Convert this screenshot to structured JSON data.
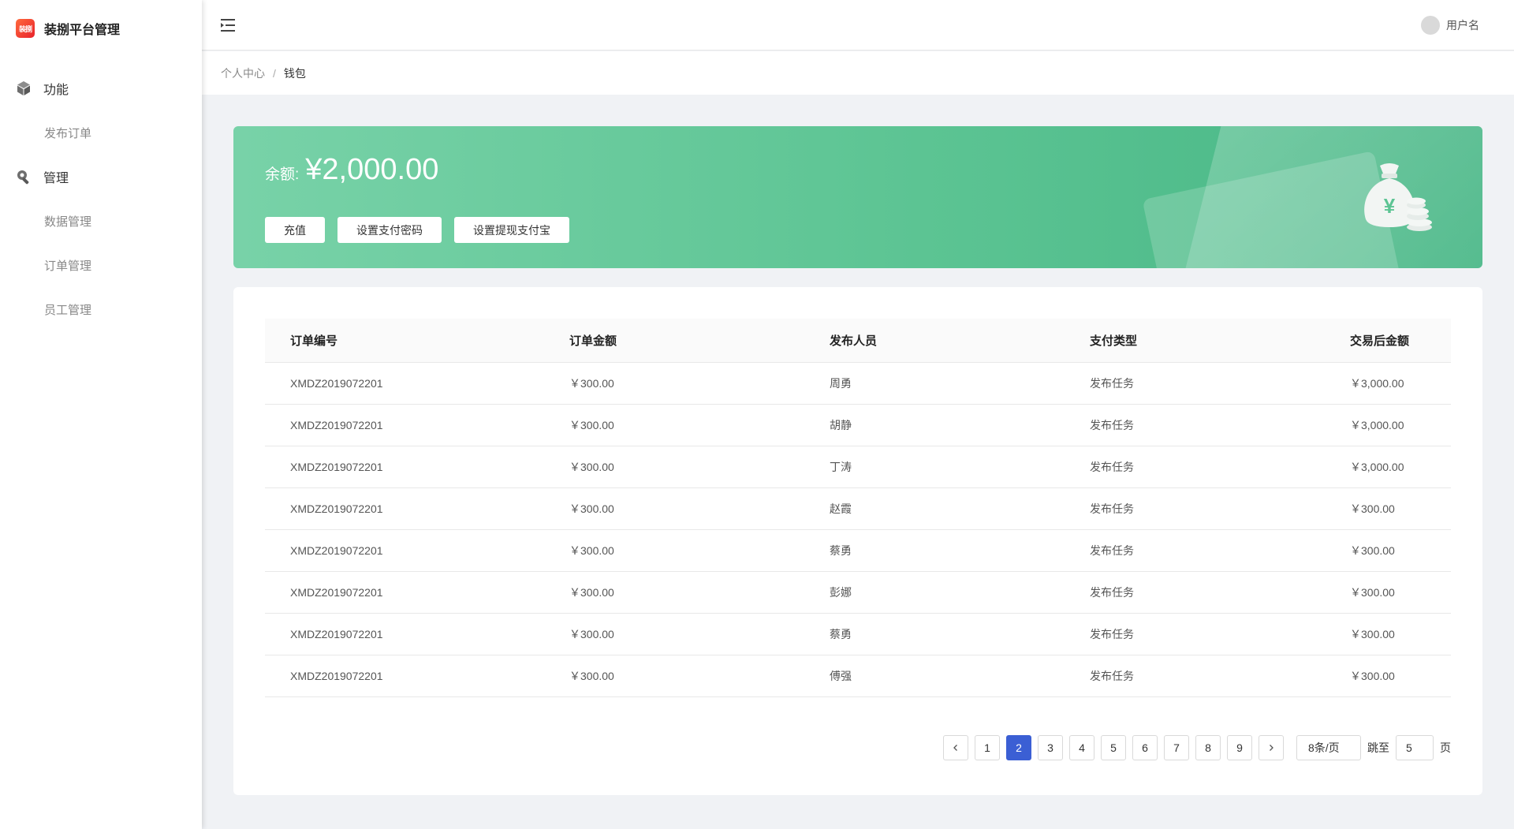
{
  "app": {
    "logo_text": "装捌",
    "title": "装捌平台管理"
  },
  "sidebar": {
    "groups": [
      {
        "label": "功能",
        "icon": "cube-icon",
        "items": [
          {
            "label": "发布订单"
          }
        ]
      },
      {
        "label": "管理",
        "icon": "wrench-icon",
        "items": [
          {
            "label": "数据管理"
          },
          {
            "label": "订单管理"
          },
          {
            "label": "员工管理"
          }
        ]
      }
    ]
  },
  "header": {
    "menu_icon": "menu-fold-icon",
    "username": "用户名"
  },
  "breadcrumb": {
    "parent": "个人中心",
    "separator": "/",
    "current": "钱包"
  },
  "wallet": {
    "balance_label": "余额:",
    "balance_amount": "¥2,000.00",
    "buttons": [
      "充值",
      "设置支付密码",
      "设置提现支付宝"
    ],
    "illustration": "money-bag-icon",
    "gradient": [
      "#78d2a8",
      "#46b685"
    ]
  },
  "table": {
    "columns": [
      "订单编号",
      "订单金额",
      "发布人员",
      "支付类型",
      "交易后金额"
    ],
    "rows": [
      [
        "XMDZ2019072201",
        "￥300.00",
        "周勇",
        "发布任务",
        "￥3,000.00"
      ],
      [
        "XMDZ2019072201",
        "￥300.00",
        "胡静",
        "发布任务",
        "￥3,000.00"
      ],
      [
        "XMDZ2019072201",
        "￥300.00",
        "丁涛",
        "发布任务",
        "￥3,000.00"
      ],
      [
        "XMDZ2019072201",
        "￥300.00",
        "赵霞",
        "发布任务",
        "￥300.00"
      ],
      [
        "XMDZ2019072201",
        "￥300.00",
        "蔡勇",
        "发布任务",
        "￥300.00"
      ],
      [
        "XMDZ2019072201",
        "￥300.00",
        "彭娜",
        "发布任务",
        "￥300.00"
      ],
      [
        "XMDZ2019072201",
        "￥300.00",
        "蔡勇",
        "发布任务",
        "￥300.00"
      ],
      [
        "XMDZ2019072201",
        "￥300.00",
        "傅强",
        "发布任务",
        "￥300.00"
      ]
    ]
  },
  "pagination": {
    "prev": "<",
    "next": ">",
    "pages": [
      "1",
      "2",
      "3",
      "4",
      "5",
      "6",
      "7",
      "8",
      "9"
    ],
    "current": "2",
    "page_size": "8条/页",
    "jump_label": "跳至",
    "jump_value": "5",
    "page_unit": "页",
    "active_color": "#3b5fd4"
  }
}
